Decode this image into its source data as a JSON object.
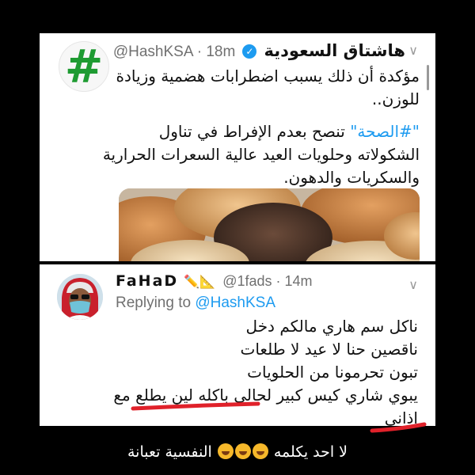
{
  "tweet1": {
    "display_name": "هاشتاق السعودية",
    "handle_time": "@HashKSA · 18m",
    "avatar_glyph": "#",
    "avatar_color": "#1e9b32",
    "verified_mark": "✓",
    "text_lines_a": [
      "مؤكدة أن ذلك يسبب اضطرابات هضمية وزيادة",
      "للوزن.."
    ],
    "hashtag": "\"#الصحة\"",
    "text_line_b1_rest": " تنصح بعدم الإفراط في تناول",
    "text_lines_b": [
      "الشكولاته وحلويات العيد عالية السعرات الحرارية",
      "والسكريات والدهون."
    ],
    "menu_icon": "∨"
  },
  "tweet2": {
    "display_name": "FaHaD",
    "name_emoji": "✏️📐",
    "handle_time": "@1fads · 14m",
    "replying_prefix": "Replying to",
    "replying_mention": "@HashKSA",
    "text_lines": [
      "ناكل سم هاري مالكم دخل",
      "ناقصين حنا لا عيد لا طلعات",
      "تبون تحرمونا من الحلويات",
      "يبوي شاري كيس كبير لحالي باكله لين يطلع مع",
      "اذاني"
    ],
    "menu_icon": "∨"
  },
  "caption": {
    "text_start": "لا احد يكلمه",
    "text_end": "النفسية تعبانة"
  },
  "colors": {
    "background": "#000000",
    "twitter_blue": "#1d9bf0",
    "underline_red": "#e0212a"
  }
}
